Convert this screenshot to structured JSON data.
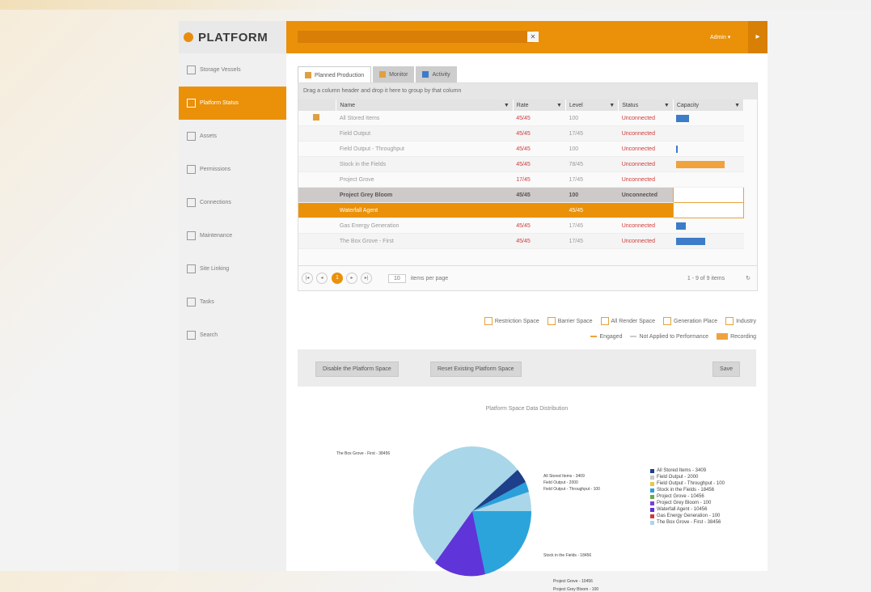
{
  "app": {
    "logo_text": "PLATFORM"
  },
  "header": {
    "search_placeholder": "",
    "search_icon": "search-icon",
    "user_label": "Admin ▾",
    "menu_icon": "menu-icon"
  },
  "sidebar": {
    "items": [
      {
        "label": "Storage Vessels",
        "active": false
      },
      {
        "label": "Platform Status",
        "active": true
      },
      {
        "label": "Assets",
        "active": false
      },
      {
        "label": "Permissions",
        "active": false
      },
      {
        "label": "Connections",
        "active": false
      },
      {
        "label": "Maintenance",
        "active": false
      },
      {
        "label": "Site Linking",
        "active": false
      },
      {
        "label": "Tasks",
        "active": false
      },
      {
        "label": "Search",
        "active": false
      }
    ]
  },
  "tabs": [
    {
      "label": "Planned Production",
      "active": true
    },
    {
      "label": "Monitor",
      "active": false
    },
    {
      "label": "Activity",
      "active": false
    }
  ],
  "grid": {
    "group_hint": "Drag a column header and drop it here to group by that column",
    "columns": [
      "Name",
      "Rate",
      "Level",
      "Status",
      "Capacity"
    ],
    "rows": [
      {
        "name": "All Stored Items",
        "rate": "45/45",
        "level": "100",
        "status": "Unconnected",
        "capacity": 0.2,
        "cap_color": "#3d7cc8",
        "style": ""
      },
      {
        "name": "Field Output",
        "rate": "45/45",
        "level": "17/45",
        "status": "Unconnected",
        "capacity": 0,
        "cap_color": "#3d7cc8",
        "style": "alt"
      },
      {
        "name": "Field Output - Throughput",
        "rate": "45/45",
        "level": "100",
        "status": "Unconnected",
        "capacity": 0.03,
        "cap_color": "#3d7cc8",
        "style": ""
      },
      {
        "name": "Stock in the Fields",
        "rate": "45/45",
        "level": "78/45",
        "status": "Unconnected",
        "capacity": 0.75,
        "cap_color": "#f0a23c",
        "style": "alt"
      },
      {
        "name": "Project Grove",
        "rate": "17/45",
        "level": "17/45",
        "status": "Unconnected",
        "capacity": 0,
        "cap_color": "#3d7cc8",
        "style": ""
      },
      {
        "name": "Project Grey Bloom",
        "rate": "45/45",
        "level": "100",
        "status": "Unconnected",
        "capacity": 0,
        "cap_color": "#3d7cc8",
        "style": "sel-grey"
      },
      {
        "name": "Waterfall Agent",
        "rate": "",
        "level": "45/45",
        "status": "",
        "capacity": 0,
        "cap_color": "#3d7cc8",
        "style": "sel-orange"
      },
      {
        "name": "Gas Energy Generation",
        "rate": "45/45",
        "level": "17/45",
        "status": "Unconnected",
        "capacity": 0.15,
        "cap_color": "#3d7cc8",
        "style": ""
      },
      {
        "name": "The Box Grove - First",
        "rate": "45/45",
        "level": "17/45",
        "status": "Unconnected",
        "capacity": 0.45,
        "cap_color": "#3d7cc8",
        "style": "alt"
      }
    ],
    "pager": {
      "current": "1",
      "page_size": "10",
      "page_size_label": "items per page",
      "info": "1 - 9 of 9 items"
    }
  },
  "legend_row1": [
    "Restriction Space",
    "Barrier Space",
    "All Render Space",
    "Generation Place",
    "Industry"
  ],
  "legend_row2": [
    "Engaged",
    "Not Applied to Performance",
    "Recording"
  ],
  "actions": {
    "disable_label": "Disable the Platform Space",
    "reset_label": "Reset Existing Platform Space",
    "save_label": "Save"
  },
  "chart": {
    "title": "Platform Space Data Distribution",
    "callouts": [
      "The Box Grove - First - 38456",
      "All Stored Items - 3409",
      "Field Output - 2000",
      "Field Output - Throughput - 100",
      "Stock in the Fields - 18456",
      "Project Grove - 10456",
      "Project Grey Bloom - 100"
    ],
    "legend": [
      {
        "label": "All Stored Items - 3409",
        "color": "#1e3f8a"
      },
      {
        "label": "Field Output - 2000",
        "color": "#c9c9c9"
      },
      {
        "label": "Field Output - Throughput - 100",
        "color": "#e6c94a"
      },
      {
        "label": "Stock in the Fields - 18456",
        "color": "#2b9fd9"
      },
      {
        "label": "Project Grove - 10456",
        "color": "#6aa84f"
      },
      {
        "label": "Project Grey Bloom - 100",
        "color": "#7d3fd1"
      },
      {
        "label": "Waterfall Agent - 10456",
        "color": "#5b2fd6"
      },
      {
        "label": "Gas Energy Generation - 100",
        "color": "#d03a3a"
      },
      {
        "label": "The Box Grove - First - 38456",
        "color": "#a9d6e8"
      }
    ]
  }
}
